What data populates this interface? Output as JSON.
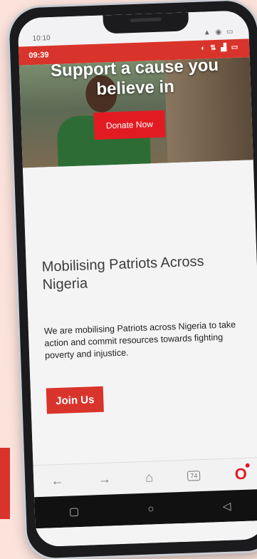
{
  "outer_status": {
    "time": "10:10",
    "icons": "▲ ◉ ▭"
  },
  "inner_status": {
    "time": "09:39",
    "icons": "◐ ⇅ ▟ ▭"
  },
  "hero": {
    "headline": "Support a cause you believe in",
    "donate_label": "Donate Now"
  },
  "content": {
    "title": "Mobilising Patriots Across Nigeria",
    "body": "We are mobilising Patriots across Nigeria to take action and commit resources towards fighting poverty and injustice.",
    "join_label": "Join Us"
  },
  "browser_bar": {
    "back": "←",
    "forward": "→",
    "home": "⌂",
    "tabs": "74",
    "opera": "O"
  },
  "nav_bar": {
    "recent": "▢",
    "home": "○",
    "back": "◁"
  },
  "colors": {
    "accent": "#d9342b",
    "background": "#fbe3dc"
  }
}
